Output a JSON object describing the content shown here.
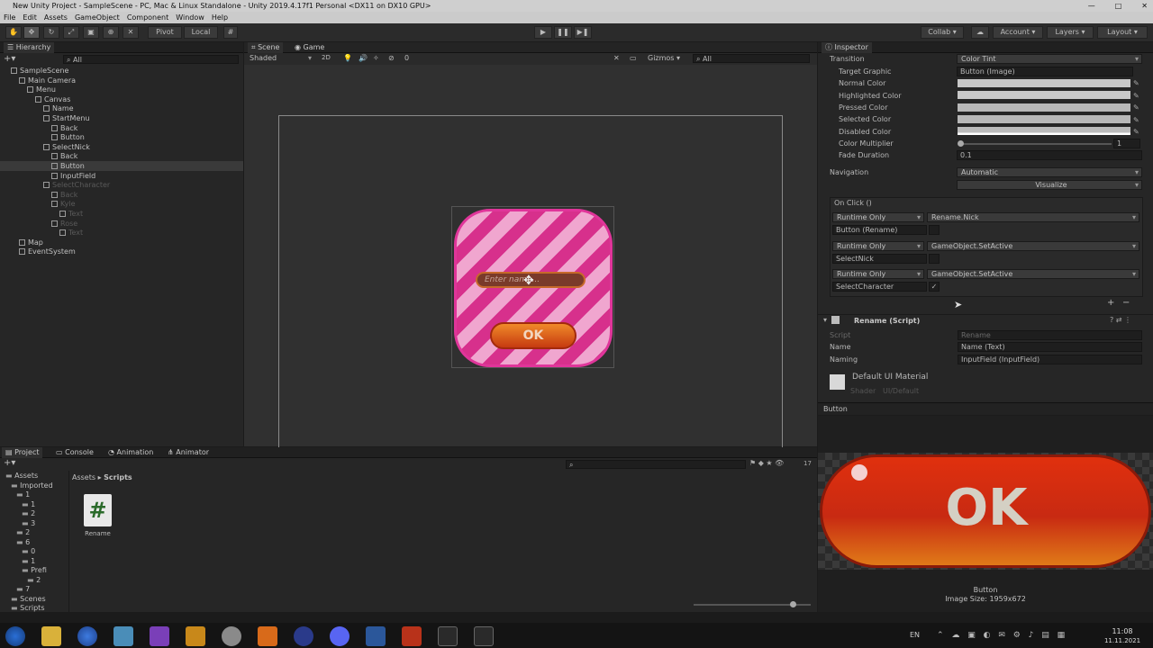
{
  "window": {
    "title": "New Unity Project - SampleScene - PC, Mac & Linux Standalone - Unity 2019.4.17f1 Personal <DX11 on DX10 GPU>",
    "controls": [
      "—",
      "□",
      "✕"
    ]
  },
  "menu": [
    "File",
    "Edit",
    "Assets",
    "GameObject",
    "Component",
    "Window",
    "Help"
  ],
  "toolbar": {
    "pivot": "Pivot",
    "local": "Local",
    "collab": "Collab",
    "account": "Account",
    "layers": "Layers",
    "layout": "Layout"
  },
  "hierarchy": {
    "tab": "Hierarchy",
    "search_placeholder": "All",
    "rows": [
      {
        "label": "SampleScene",
        "depth": 0,
        "state": "normal"
      },
      {
        "label": "Main Camera",
        "depth": 1,
        "state": "normal"
      },
      {
        "label": "Menu",
        "depth": 2,
        "state": "normal"
      },
      {
        "label": "Canvas",
        "depth": 3,
        "state": "normal"
      },
      {
        "label": "Name",
        "depth": 4,
        "state": "normal"
      },
      {
        "label": "StartMenu",
        "depth": 4,
        "state": "normal"
      },
      {
        "label": "Back",
        "depth": 5,
        "state": "normal"
      },
      {
        "label": "Button",
        "depth": 5,
        "state": "normal"
      },
      {
        "label": "SelectNick",
        "depth": 4,
        "state": "normal"
      },
      {
        "label": "Back",
        "depth": 5,
        "state": "normal"
      },
      {
        "label": "Button",
        "depth": 5,
        "state": "selected"
      },
      {
        "label": "InputField",
        "depth": 5,
        "state": "normal"
      },
      {
        "label": "SelectCharacter",
        "depth": 4,
        "state": "dim"
      },
      {
        "label": "Back",
        "depth": 5,
        "state": "dim"
      },
      {
        "label": "Kyle",
        "depth": 5,
        "state": "dim"
      },
      {
        "label": "Text",
        "depth": 6,
        "state": "dim"
      },
      {
        "label": "Rose",
        "depth": 5,
        "state": "dim"
      },
      {
        "label": "Text",
        "depth": 6,
        "state": "dim"
      },
      {
        "label": "Map",
        "depth": 1,
        "state": "normal"
      },
      {
        "label": "EventSystem",
        "depth": 1,
        "state": "normal"
      }
    ]
  },
  "scene": {
    "tabs": [
      "Scene",
      "Game"
    ],
    "shading": "Shaded",
    "mode2d": "2D",
    "gizmos": "Gizmos",
    "search_placeholder": "All",
    "layer_count": "0",
    "input_placeholder": "Enter name...",
    "ok_label": "OK"
  },
  "inspector": {
    "tab": "Inspector",
    "transition": {
      "label": "Transition",
      "value": "Color Tint"
    },
    "target_graphic": {
      "label": "Target Graphic",
      "value": "Button (Image)"
    },
    "colors": [
      "Normal Color",
      "Highlighted Color",
      "Pressed Color",
      "Selected Color",
      "Disabled Color"
    ],
    "color_multiplier": {
      "label": "Color Multiplier",
      "value": "1"
    },
    "fade_duration": {
      "label": "Fade Duration",
      "value": "0.1"
    },
    "navigation": {
      "label": "Navigation",
      "value": "Automatic"
    },
    "visualize": "Visualize",
    "onclick": {
      "title": "On Click ()",
      "entries": [
        {
          "mode": "Runtime Only",
          "func": "Rename.Nick",
          "target": "Button (Rename)",
          "arg": ""
        },
        {
          "mode": "Runtime Only",
          "func": "GameObject.SetActive",
          "target": "SelectNick",
          "arg": ""
        },
        {
          "mode": "Runtime Only",
          "func": "GameObject.SetActive",
          "target": "SelectCharacter",
          "arg": "✓"
        }
      ],
      "add": "+",
      "remove": "−"
    },
    "rename": {
      "title": "Rename (Script)",
      "script_label": "Script",
      "script_value": "Rename",
      "name_label": "Name",
      "name_value": "Name (Text)",
      "naming_label": "Naming",
      "naming_value": "InputField (InputField)"
    },
    "material": {
      "title": "Default UI Material",
      "shader_label": "Shader",
      "shader_value": "UI/Default"
    },
    "preview": {
      "header": "Button",
      "ok_label": "OK",
      "name": "Button",
      "size": "Image Size: 1959x672"
    }
  },
  "project": {
    "tabs": [
      "Project",
      "Console",
      "Animation",
      "Animator"
    ],
    "tree": [
      "Assets",
      "Imported",
      "1",
      "1",
      "2",
      "3",
      "2",
      "6",
      "0",
      "1",
      "Prefi",
      "2",
      "7",
      "Scenes",
      "Scripts"
    ],
    "breadcrumb": [
      "Assets",
      "Scripts"
    ],
    "count": "17",
    "asset": {
      "name": "Rename",
      "glyph": "#"
    }
  },
  "taskbar": {
    "lang": "EN",
    "time": "11:08",
    "date": "11.11.2021"
  },
  "colors": {
    "pink": "#e0359a",
    "orange": "#e05a1a",
    "red": "#d8281a",
    "accent": "#4a7fc1"
  }
}
